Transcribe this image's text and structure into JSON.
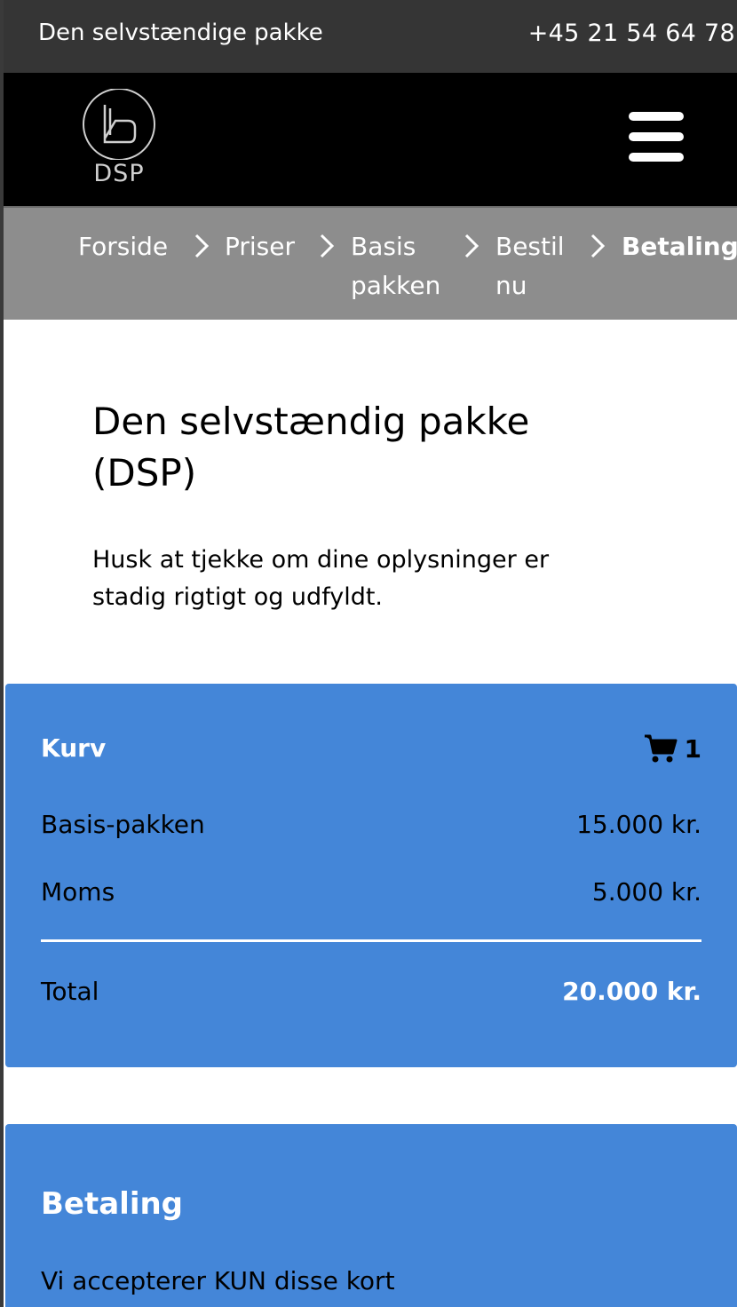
{
  "topbar": {
    "tagline": "Den selvstændige pakke",
    "phone": "+45 21 54 64 78"
  },
  "header": {
    "logo_text": "DSP",
    "menu_icon": "hamburger-menu-icon"
  },
  "breadcrumb": {
    "items": [
      {
        "label": "Forside"
      },
      {
        "label": "Priser"
      },
      {
        "label": "Basis pakken"
      },
      {
        "label": "Bestil nu"
      },
      {
        "label": "Betaling"
      }
    ],
    "separator_icon": "chevron-right-icon"
  },
  "main": {
    "title": "Den selvstændig pakke (DSP)",
    "intro": "Husk at tjekke om dine oplysninger er stadig rigtigt og udfyldt."
  },
  "cart": {
    "title": "Kurv",
    "cart_icon": "shopping-cart-icon",
    "count": "1",
    "lines": [
      {
        "label": "Basis-pakken",
        "value": "15.000 kr."
      },
      {
        "label": "Moms",
        "value": "5.000 kr."
      }
    ],
    "total_label": "Total",
    "total_value": "20.000 kr."
  },
  "payment": {
    "title": "Betaling",
    "note": "Vi accepterer KUN disse kort"
  },
  "colors": {
    "topbar": "#353535",
    "header": "#000000",
    "breadcrumb": "#8d8d8d",
    "panel": "#4486d8"
  }
}
